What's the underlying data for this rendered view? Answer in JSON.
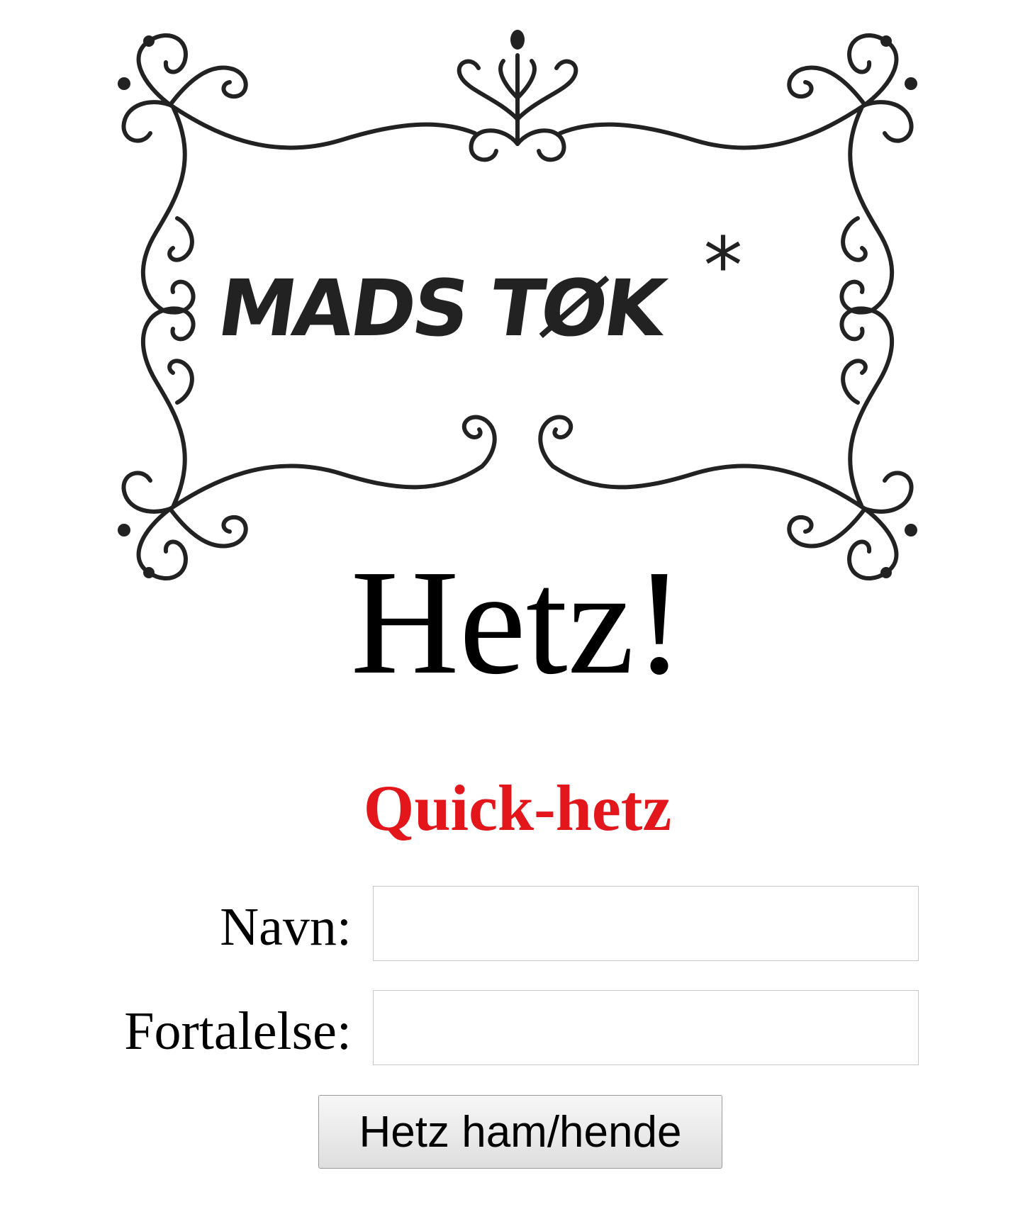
{
  "logo": {
    "brand_text": "MADS TØK",
    "asterisk": "*",
    "icon": "ornamental-frame-logo"
  },
  "page": {
    "title": "Hetz!"
  },
  "quick": {
    "title": "Quick-hetz",
    "title_color": "#e3161b",
    "name_label": "Navn:",
    "name_value": "",
    "story_label": "Fortalelse:",
    "story_value": "",
    "submit_label": "Hetz ham/hende"
  }
}
